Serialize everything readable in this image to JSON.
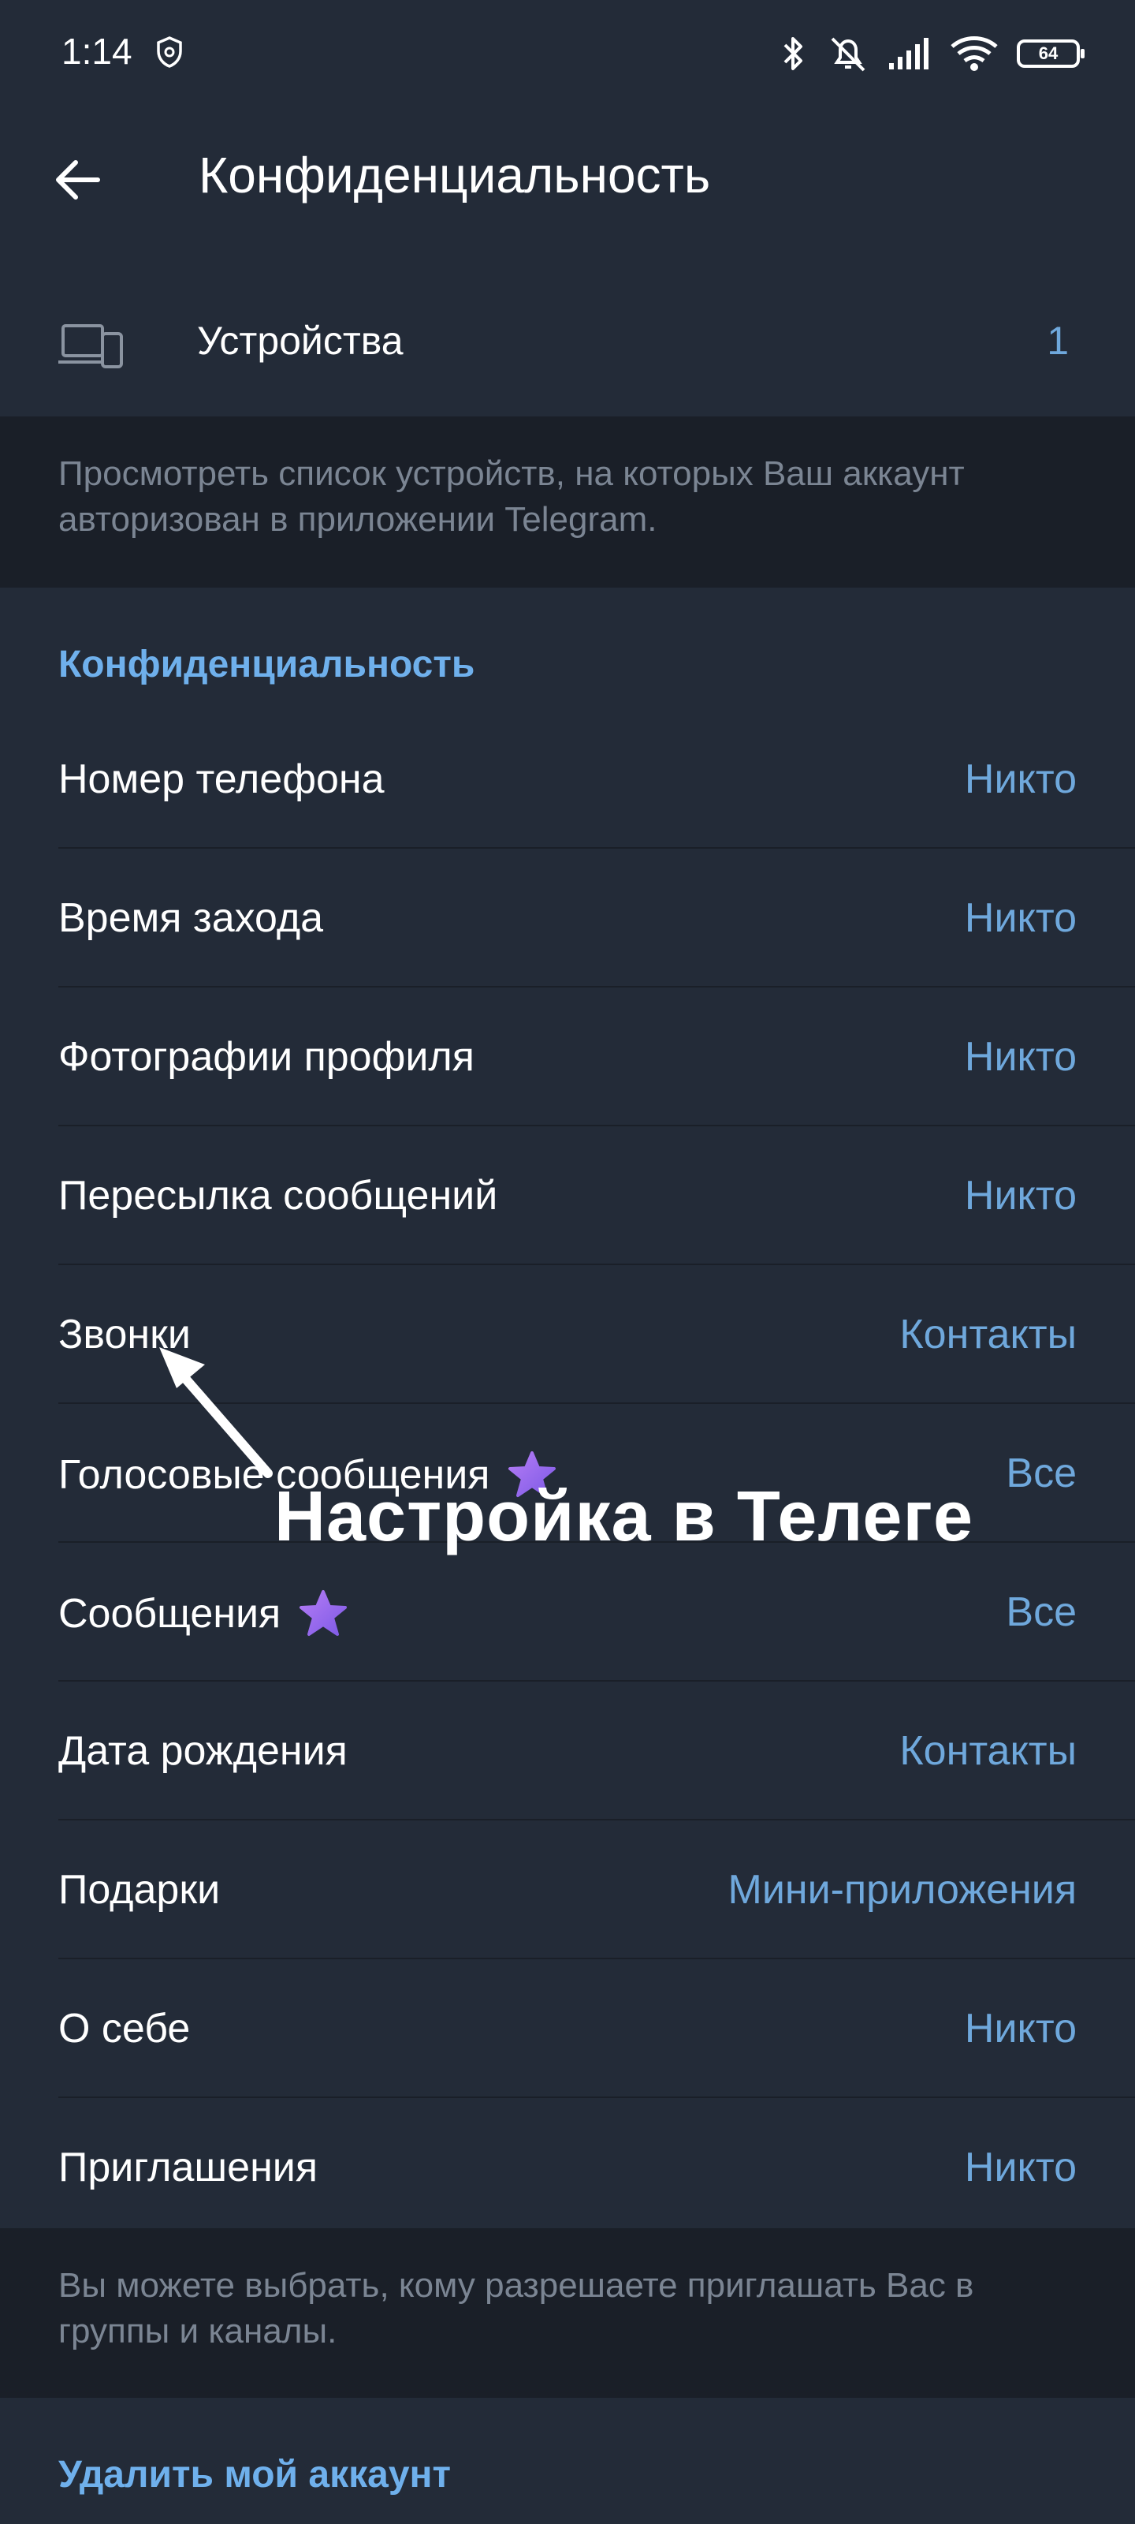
{
  "status_bar": {
    "time": "1:14",
    "battery": "64",
    "icons": [
      "shield-icon",
      "bluetooth-icon",
      "mute-icon",
      "signal-icon",
      "wifi-icon",
      "battery-icon"
    ]
  },
  "app_bar": {
    "title": "Конфиденциальность"
  },
  "devices": {
    "label": "Устройства",
    "count": "1",
    "info": "Просмотреть список устройств, на которых Ваш аккаунт авторизован в приложении Telegram."
  },
  "privacy": {
    "header": "Конфиденциальность",
    "items": [
      {
        "label": "Номер телефона",
        "value": "Никто"
      },
      {
        "label": "Время захода",
        "value": "Никто"
      },
      {
        "label": "Фотографии профиля",
        "value": "Никто"
      },
      {
        "label": "Пересылка сообщений",
        "value": "Никто"
      },
      {
        "label": "Звонки",
        "value": "Контакты"
      },
      {
        "label": "Голосовые сообщения",
        "value": "Все",
        "premium": true
      },
      {
        "label": "Сообщения",
        "value": "Все",
        "premium": true
      },
      {
        "label": "Дата рождения",
        "value": "Контакты"
      },
      {
        "label": "Подарки",
        "value": "Мини-приложения"
      },
      {
        "label": "О себе",
        "value": "Никто"
      },
      {
        "label": "Приглашения",
        "value": "Никто"
      }
    ],
    "footer": "Вы можете выбрать, кому разрешаете приглашать Вас в группы и каналы."
  },
  "delete_account": {
    "label": "Удалить мой аккаунт"
  },
  "overlay": {
    "caption": "Настройка в Телеге"
  },
  "colors": {
    "background": "#232b38",
    "info_background": "#1a1f28",
    "accent": "#6fa8dc",
    "header_accent": "#6fb0ec",
    "premium_star": "#9b6cf0"
  }
}
